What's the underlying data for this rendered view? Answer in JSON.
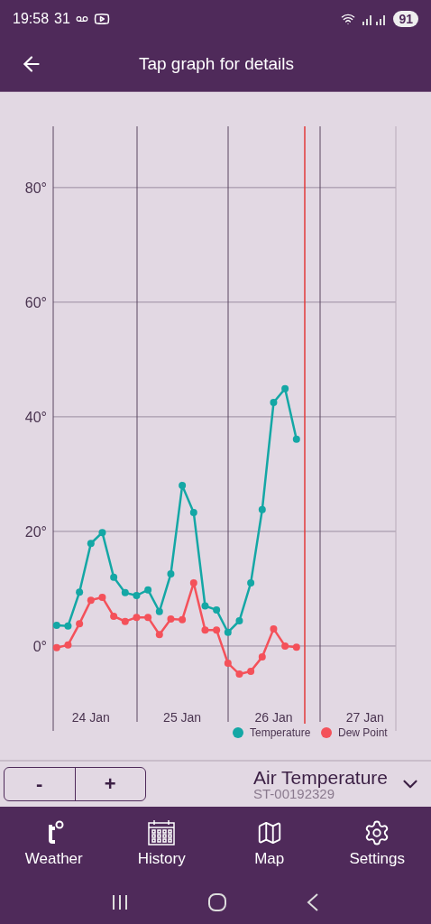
{
  "status_bar": {
    "time": "19:58",
    "date": "31",
    "battery": "91"
  },
  "app_bar": {
    "title": "Tap graph for details"
  },
  "chart": {
    "chart_data": {
      "type": "line",
      "ylim": [
        -13,
        91
      ],
      "grid": true,
      "legend": "bottom-right",
      "categories": [
        null,
        null,
        null,
        "24 Jan",
        null,
        null,
        null,
        null,
        null,
        null,
        null,
        "25 Jan",
        null,
        null,
        null,
        null,
        null,
        null,
        null,
        "26 Jan",
        null,
        null,
        null,
        null,
        null,
        null,
        null,
        "27 Jan",
        null,
        null
      ],
      "yticks": [
        {
          "value": 0,
          "label": "0°"
        },
        {
          "value": 20,
          "label": "20°"
        },
        {
          "value": 40,
          "label": "40°"
        },
        {
          "value": 60,
          "label": "60°"
        },
        {
          "value": 80,
          "label": "80°"
        }
      ],
      "series": [
        {
          "name": "Temperature",
          "color": "#14a7a5",
          "marker": "circle",
          "values": [
            3.6,
            3.5,
            9.4,
            17.9,
            19.8,
            12.0,
            9.3,
            8.8,
            9.8,
            6.0,
            12.6,
            28.0,
            23.3,
            7.0,
            6.3,
            2.4,
            4.4,
            11.0,
            23.8,
            42.5,
            44.9,
            36.1,
            null,
            null,
            null,
            null,
            null,
            null,
            null,
            null
          ]
        },
        {
          "name": "Dew Point",
          "color": "#f4515a",
          "marker": "circle",
          "values": [
            -0.3,
            0.2,
            3.9,
            8.0,
            8.5,
            5.2,
            4.3,
            5.0,
            5.0,
            2.0,
            4.7,
            4.6,
            11.0,
            2.8,
            2.8,
            -3.0,
            -4.9,
            -4.4,
            -1.9,
            3.0,
            0,
            -0.2,
            null,
            null,
            null,
            null,
            null,
            null,
            null,
            null
          ]
        }
      ]
    }
  },
  "zoom_buttons": [
    {
      "label": "-"
    },
    {
      "label": "+"
    }
  ],
  "sensor": {
    "name": "Air Temperature",
    "id": "ST-00192329"
  },
  "bottom_nav": [
    {
      "label": "Weather",
      "kind": "weather"
    },
    {
      "label": "History",
      "kind": "history"
    },
    {
      "label": "Map",
      "kind": "map"
    },
    {
      "label": "Settings",
      "kind": "settings"
    }
  ]
}
